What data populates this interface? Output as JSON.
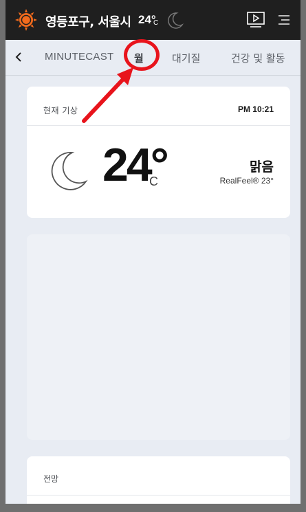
{
  "header": {
    "location": "영등포구, 서울시",
    "temp": "24°",
    "unit": "C",
    "icons": [
      "sun-icon",
      "moon-icon",
      "video-play-icon",
      "menu-icon"
    ]
  },
  "tabs": [
    {
      "label": "MINUTECAST"
    },
    {
      "label": "월"
    },
    {
      "label": "대기질"
    },
    {
      "label": "건강 및 활동"
    }
  ],
  "current": {
    "label": "현재 기상",
    "time": "PM 10:21",
    "temp": "24°",
    "unit": "C",
    "condition": "맑음",
    "realfeel": "RealFeel® 23°"
  },
  "forecast": {
    "label": "전망"
  },
  "colors": {
    "header_bg": "#1f1f1f",
    "accent_orange": "#f26b1d",
    "annotation_red": "#e8141c",
    "page_bg": "#e8ecf3"
  }
}
